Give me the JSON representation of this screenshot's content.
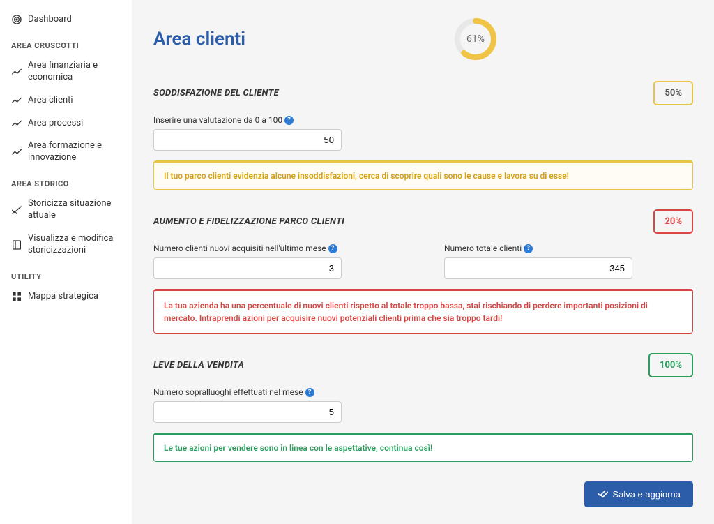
{
  "sidebar": {
    "dashboard": "Dashboard",
    "section_cruscotti": "AREA CRUSCOTTI",
    "items_cruscotti": [
      "Area finanziaria e economica",
      "Area clienti",
      "Area processi",
      "Area formazione e innovazione"
    ],
    "section_storico": "AREA STORICO",
    "items_storico": [
      "Storicizza situazione attuale",
      "Visualizza e modifica storicizzazioni"
    ],
    "section_utility": "UTILITY",
    "items_utility": [
      "Mappa strategica"
    ]
  },
  "page": {
    "title": "Area clienti",
    "gauge_percent": "61%",
    "gauge_value": 61
  },
  "sections": {
    "soddisfazione": {
      "title": "SODDISFAZIONE DEL CLIENTE",
      "badge": "50%",
      "field_label": "Inserire una valutazione da 0 a 100",
      "field_value": "50",
      "alert": "Il tuo parco clienti evidenzia alcune insoddisfazioni, cerca di scoprire quali sono le cause e lavora su di esse!"
    },
    "aumento": {
      "title": "AUMENTO E FIDELIZZAZIONE PARCO CLIENTI",
      "badge": "20%",
      "field1_label": "Numero clienti nuovi acquisiti nell'ultimo mese",
      "field1_value": "3",
      "field2_label": "Numero totale clienti",
      "field2_value": "345",
      "alert": "La tua azienda ha una percentuale di nuovi clienti rispetto al totale troppo bassa, stai rischiando di perdere importanti posizioni di mercato. Intraprendi azioni per acquisire nuovi potenziali clienti prima che sia troppo tardi!"
    },
    "leve": {
      "title": "LEVE DELLA VENDITA",
      "badge": "100%",
      "field_label": "Numero sopralluoghi effettuati nel mese",
      "field_value": "5",
      "alert": "Le tue azioni per vendere sono in linea con le aspettative, continua così!"
    }
  },
  "actions": {
    "save": "Salva e aggiorna"
  }
}
